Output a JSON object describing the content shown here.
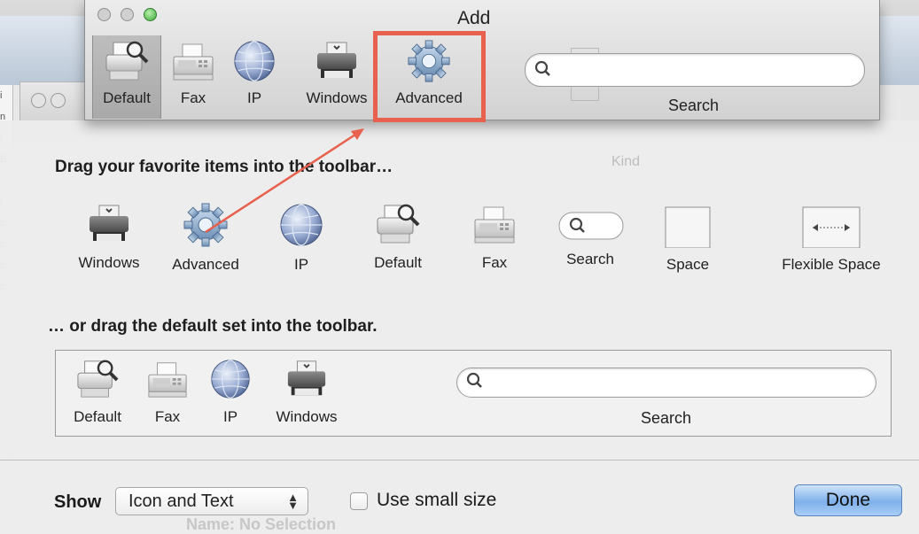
{
  "window": {
    "title": "Add"
  },
  "toolbar": {
    "items": [
      {
        "label": "Default",
        "icon": "default-printer-icon"
      },
      {
        "label": "Fax",
        "icon": "fax-icon"
      },
      {
        "label": "IP",
        "icon": "ip-globe-icon"
      },
      {
        "label": "Windows",
        "icon": "windows-printer-icon"
      },
      {
        "label": "Advanced",
        "icon": "gear-icon"
      }
    ],
    "search_label": "Search",
    "search_placeholder": ""
  },
  "palette": {
    "heading": "Drag your favorite items into the toolbar…",
    "items": [
      {
        "label": "Windows",
        "icon": "windows-printer-icon"
      },
      {
        "label": "Advanced",
        "icon": "gear-icon"
      },
      {
        "label": "IP",
        "icon": "ip-globe-icon"
      },
      {
        "label": "Default",
        "icon": "default-printer-icon"
      },
      {
        "label": "Fax",
        "icon": "fax-icon"
      },
      {
        "label": "Search",
        "icon": "search-field-icon"
      },
      {
        "label": "Space",
        "icon": "space-icon"
      },
      {
        "label": "Flexible Space",
        "icon": "flexible-space-icon"
      }
    ]
  },
  "default_set": {
    "heading": "… or drag the default set into the toolbar.",
    "items": [
      {
        "label": "Default"
      },
      {
        "label": "Fax"
      },
      {
        "label": "IP"
      },
      {
        "label": "Windows"
      }
    ],
    "search_label": "Search"
  },
  "bottom": {
    "show_label": "Show",
    "show_value": "Icon and Text",
    "use_small_size_label": "Use small size",
    "use_small_size_checked": false,
    "done_label": "Done"
  },
  "background": {
    "kind_label": "Kind",
    "name_label": "Name: No Selection"
  },
  "colors": {
    "highlight": "#e8604e",
    "done_button": "#7fb0ea",
    "close_light": "#d0d0d0",
    "zoom_light": "#4fc14a"
  }
}
